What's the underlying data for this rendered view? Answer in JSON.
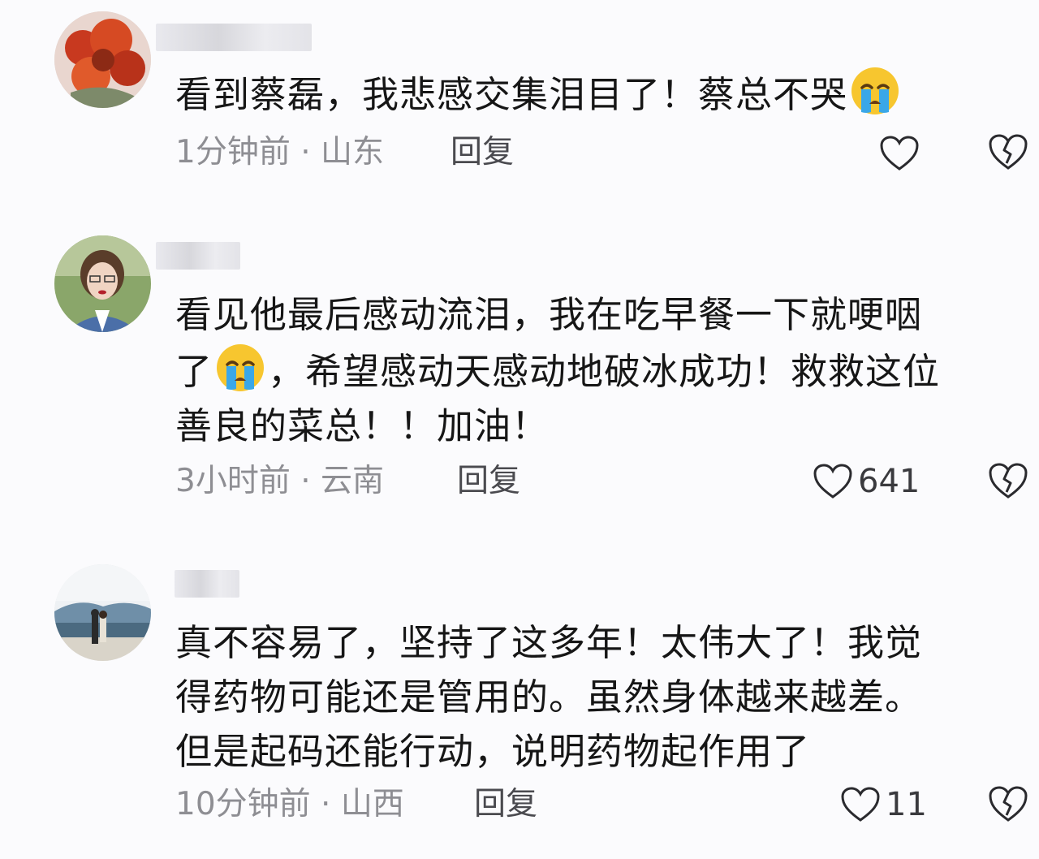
{
  "comments": [
    {
      "text": "看到蔡磊，我悲感交集泪目了！蔡总不哭",
      "time": "1分钟前",
      "separator": "·",
      "location": "山东",
      "reply_label": "回复",
      "likes": "",
      "emoji": "crying-face"
    },
    {
      "line1": "看见他最后感动流泪，我在吃早餐一下就哽咽",
      "line2a": "了",
      "line2b": "，希望感动天感动地破冰成功！救救这位",
      "line3": "善良的菜总！！加油！",
      "time": "3小时前",
      "separator": "·",
      "location": "云南",
      "reply_label": "回复",
      "likes": "641",
      "emoji": "crying-face"
    },
    {
      "line1": "真不容易了，坚持了这多年！太伟大了！我觉",
      "line2": "得药物可能还是管用的。虽然身体越来越差。",
      "line3": "但是起码还能行动，说明药物起作用了",
      "time": "10分钟前",
      "separator": "·",
      "location": "山西",
      "reply_label": "回复",
      "likes": "11"
    }
  ],
  "icons": {
    "like": "heart-outline-icon",
    "dislike": "broken-heart-icon"
  }
}
